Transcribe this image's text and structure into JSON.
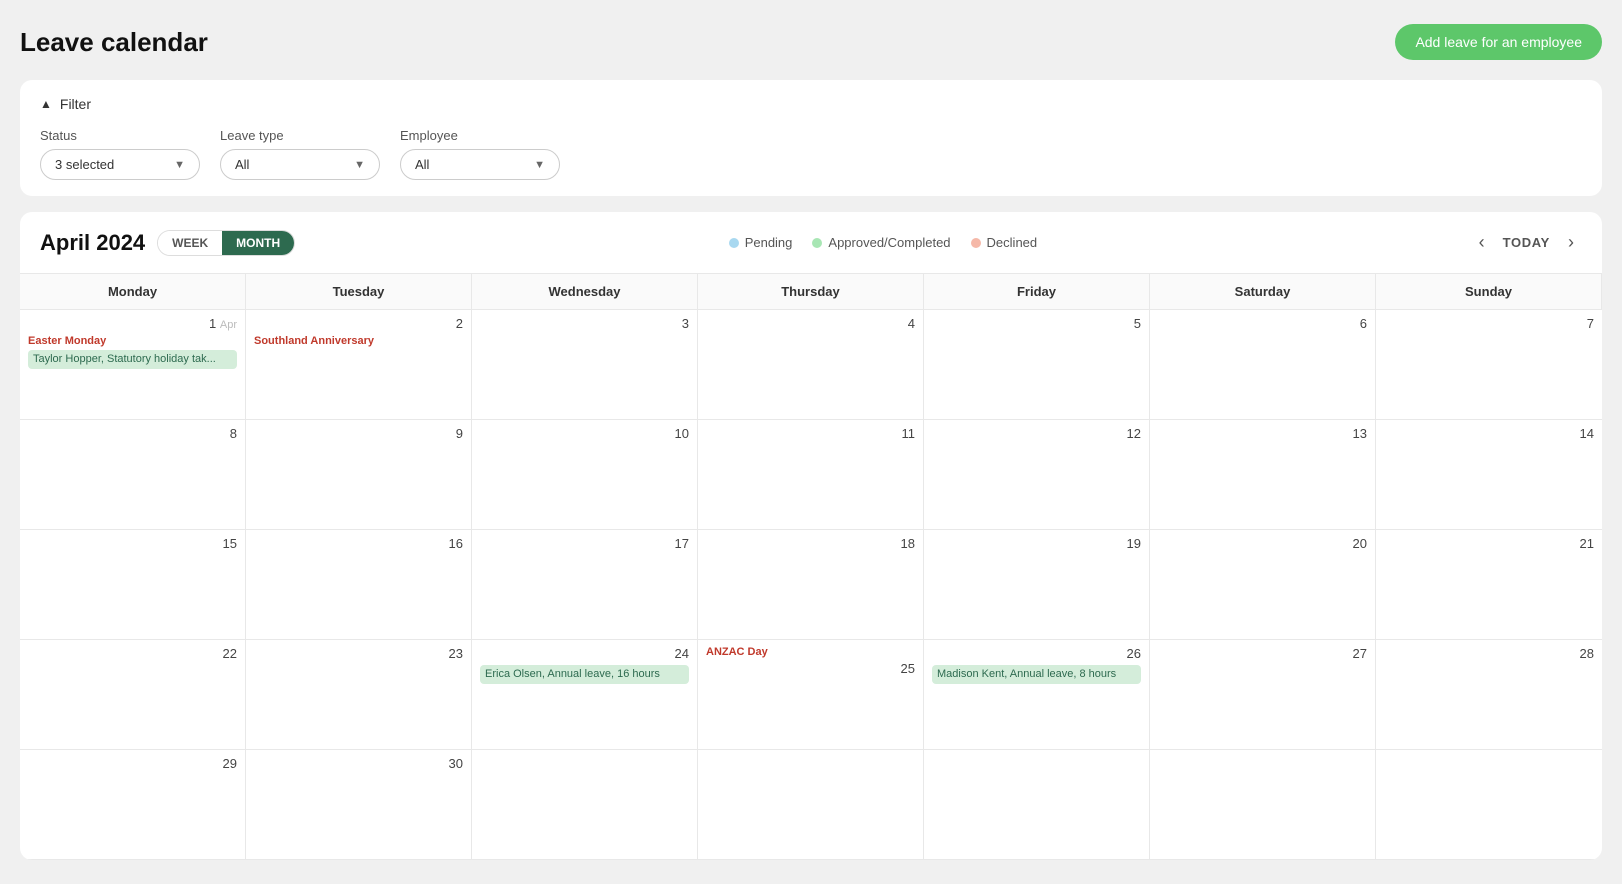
{
  "header": {
    "title": "Leave calendar",
    "add_button_label": "Add leave for an employee"
  },
  "filter": {
    "toggle_label": "Filter",
    "toggle_icon": "▲",
    "fields": [
      {
        "label": "Status",
        "value": "3 selected",
        "key": "status"
      },
      {
        "label": "Leave type",
        "value": "All",
        "key": "leave_type"
      },
      {
        "label": "Employee",
        "value": "All",
        "key": "employee"
      }
    ]
  },
  "calendar": {
    "month_title": "April 2024",
    "view_tabs": [
      {
        "label": "WEEK",
        "active": false
      },
      {
        "label": "MONTH",
        "active": true
      }
    ],
    "legend": [
      {
        "label": "Pending",
        "type": "pending"
      },
      {
        "label": "Approved/Completed",
        "type": "approved"
      },
      {
        "label": "Declined",
        "type": "declined"
      }
    ],
    "nav": {
      "prev": "‹",
      "today": "TODAY",
      "next": "›"
    },
    "day_headers": [
      "Monday",
      "Tuesday",
      "Wednesday",
      "Thursday",
      "Friday",
      "Saturday",
      "Sunday"
    ],
    "rows": [
      [
        {
          "num": "Apr 1",
          "apr_label": "Apr",
          "holiday": "Easter Monday",
          "events": [
            {
              "text": "Taylor Hopper, Statutory holiday tak...",
              "type": "approved"
            }
          ]
        },
        {
          "num": "2",
          "holiday": "Southland Anniversary",
          "events": []
        },
        {
          "num": "3",
          "events": []
        },
        {
          "num": "4",
          "events": []
        },
        {
          "num": "5",
          "events": []
        },
        {
          "num": "6",
          "events": []
        },
        {
          "num": "7",
          "events": []
        }
      ],
      [
        {
          "num": "8",
          "events": []
        },
        {
          "num": "9",
          "events": []
        },
        {
          "num": "10",
          "events": []
        },
        {
          "num": "11",
          "events": []
        },
        {
          "num": "12",
          "events": []
        },
        {
          "num": "13",
          "events": []
        },
        {
          "num": "14",
          "events": []
        }
      ],
      [
        {
          "num": "15",
          "events": []
        },
        {
          "num": "16",
          "events": []
        },
        {
          "num": "17",
          "events": []
        },
        {
          "num": "18",
          "events": []
        },
        {
          "num": "19",
          "events": []
        },
        {
          "num": "20",
          "events": []
        },
        {
          "num": "21",
          "events": []
        }
      ],
      [
        {
          "num": "22",
          "events": []
        },
        {
          "num": "23",
          "events": []
        },
        {
          "num": "24",
          "events": [
            {
              "text": "Erica Olsen, Annual leave, 16 hours",
              "type": "approved"
            }
          ]
        },
        {
          "num": "25",
          "holiday": "ANZAC Day",
          "events": []
        },
        {
          "num": "26",
          "events": [
            {
              "text": "Madison Kent, Annual leave, 8 hours",
              "type": "approved"
            }
          ]
        },
        {
          "num": "27",
          "events": []
        },
        {
          "num": "28",
          "events": []
        }
      ],
      [
        {
          "num": "29",
          "events": []
        },
        {
          "num": "30",
          "events": []
        },
        {
          "num": "",
          "events": []
        },
        {
          "num": "",
          "events": []
        },
        {
          "num": "",
          "events": []
        },
        {
          "num": "",
          "events": []
        },
        {
          "num": "",
          "events": []
        }
      ]
    ]
  }
}
